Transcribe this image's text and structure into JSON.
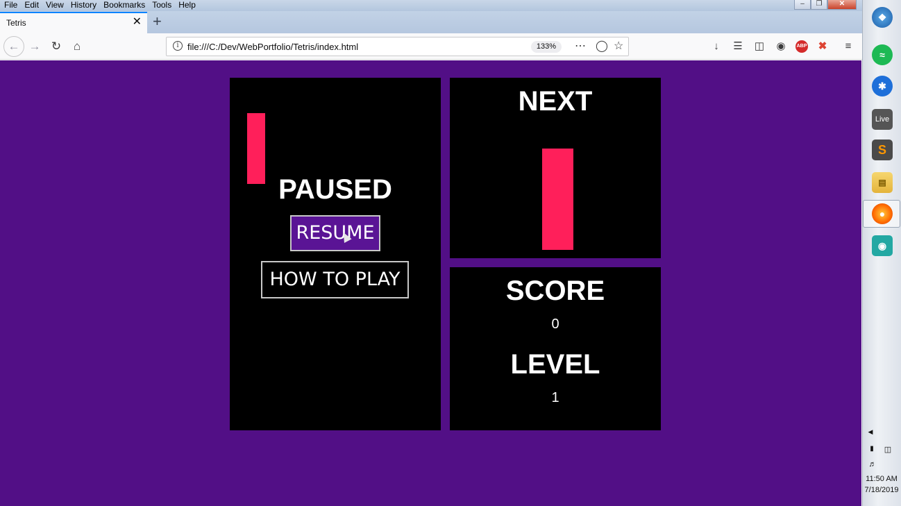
{
  "browser": {
    "menu": [
      "File",
      "Edit",
      "View",
      "History",
      "Bookmarks",
      "Tools",
      "Help"
    ],
    "tab_title": "Tetris",
    "url": "file:///C:/Dev/WebPortfolio/Tetris/index.html",
    "zoom": "133%"
  },
  "game": {
    "paused_title": "PAUSED",
    "resume_label": "RESUME",
    "how_to_play_label": "HOW TO PLAY",
    "next_heading": "NEXT",
    "score_heading": "SCORE",
    "score_value": "0",
    "level_heading": "LEVEL",
    "level_value": "1"
  },
  "colors": {
    "background": "#520f86",
    "panel": "#000000",
    "piece": "#ff1f5a",
    "resume_button": "#5a1495"
  },
  "taskbar": {
    "live_label": "Live",
    "time": "11:50 AM",
    "date": "7/18/2019"
  }
}
